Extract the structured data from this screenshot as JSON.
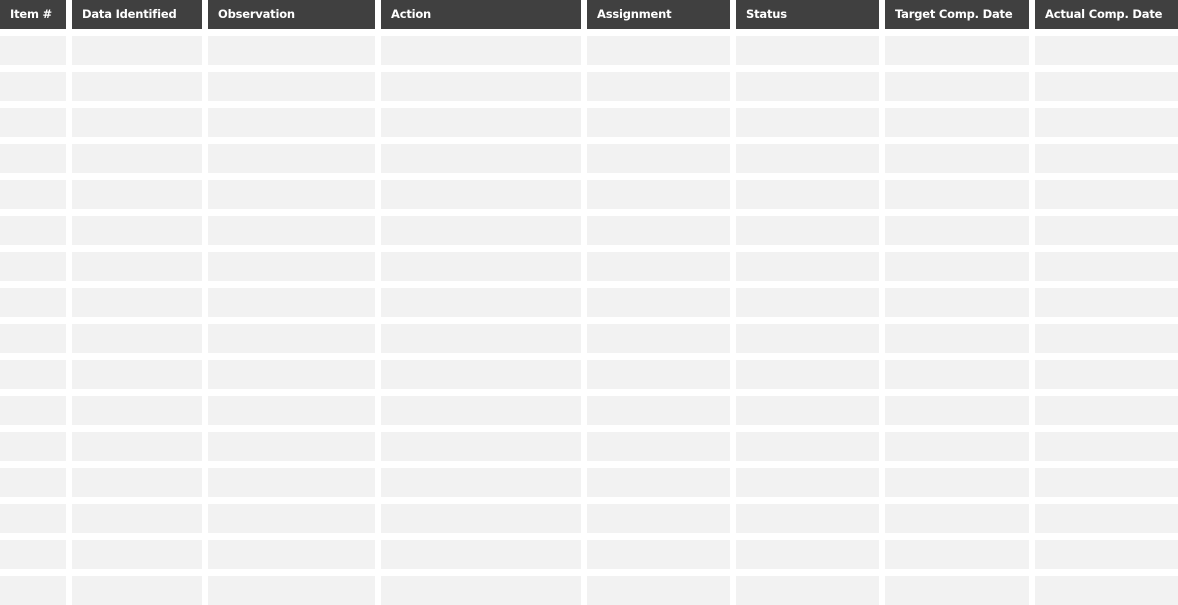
{
  "table": {
    "name": "action-item-tracker",
    "columns": [
      {
        "key": "item_no",
        "label": "Item #"
      },
      {
        "key": "data_identified",
        "label": "Data Identified"
      },
      {
        "key": "observation",
        "label": "Observation"
      },
      {
        "key": "action",
        "label": "Action"
      },
      {
        "key": "assignment",
        "label": "Assignment"
      },
      {
        "key": "status",
        "label": "Status"
      },
      {
        "key": "target_comp_date",
        "label": "Target Comp. Date"
      },
      {
        "key": "actual_comp_date",
        "label": "Actual Comp. Date"
      }
    ],
    "rows": [
      [
        "",
        "",
        "",
        "",
        "",
        "",
        "",
        ""
      ],
      [
        "",
        "",
        "",
        "",
        "",
        "",
        "",
        ""
      ],
      [
        "",
        "",
        "",
        "",
        "",
        "",
        "",
        ""
      ],
      [
        "",
        "",
        "",
        "",
        "",
        "",
        "",
        ""
      ],
      [
        "",
        "",
        "",
        "",
        "",
        "",
        "",
        ""
      ],
      [
        "",
        "",
        "",
        "",
        "",
        "",
        "",
        ""
      ],
      [
        "",
        "",
        "",
        "",
        "",
        "",
        "",
        ""
      ],
      [
        "",
        "",
        "",
        "",
        "",
        "",
        "",
        ""
      ],
      [
        "",
        "",
        "",
        "",
        "",
        "",
        "",
        ""
      ],
      [
        "",
        "",
        "",
        "",
        "",
        "",
        "",
        ""
      ],
      [
        "",
        "",
        "",
        "",
        "",
        "",
        "",
        ""
      ],
      [
        "",
        "",
        "",
        "",
        "",
        "",
        "",
        ""
      ],
      [
        "",
        "",
        "",
        "",
        "",
        "",
        "",
        ""
      ],
      [
        "",
        "",
        "",
        "",
        "",
        "",
        "",
        ""
      ],
      [
        "",
        "",
        "",
        "",
        "",
        "",
        "",
        ""
      ],
      [
        "",
        "",
        "",
        "",
        "",
        "",
        "",
        ""
      ]
    ]
  },
  "colors": {
    "header_background": "#404040",
    "header_text": "#ffffff",
    "cell_background": "#f2f2f2",
    "gap": "#ffffff"
  }
}
